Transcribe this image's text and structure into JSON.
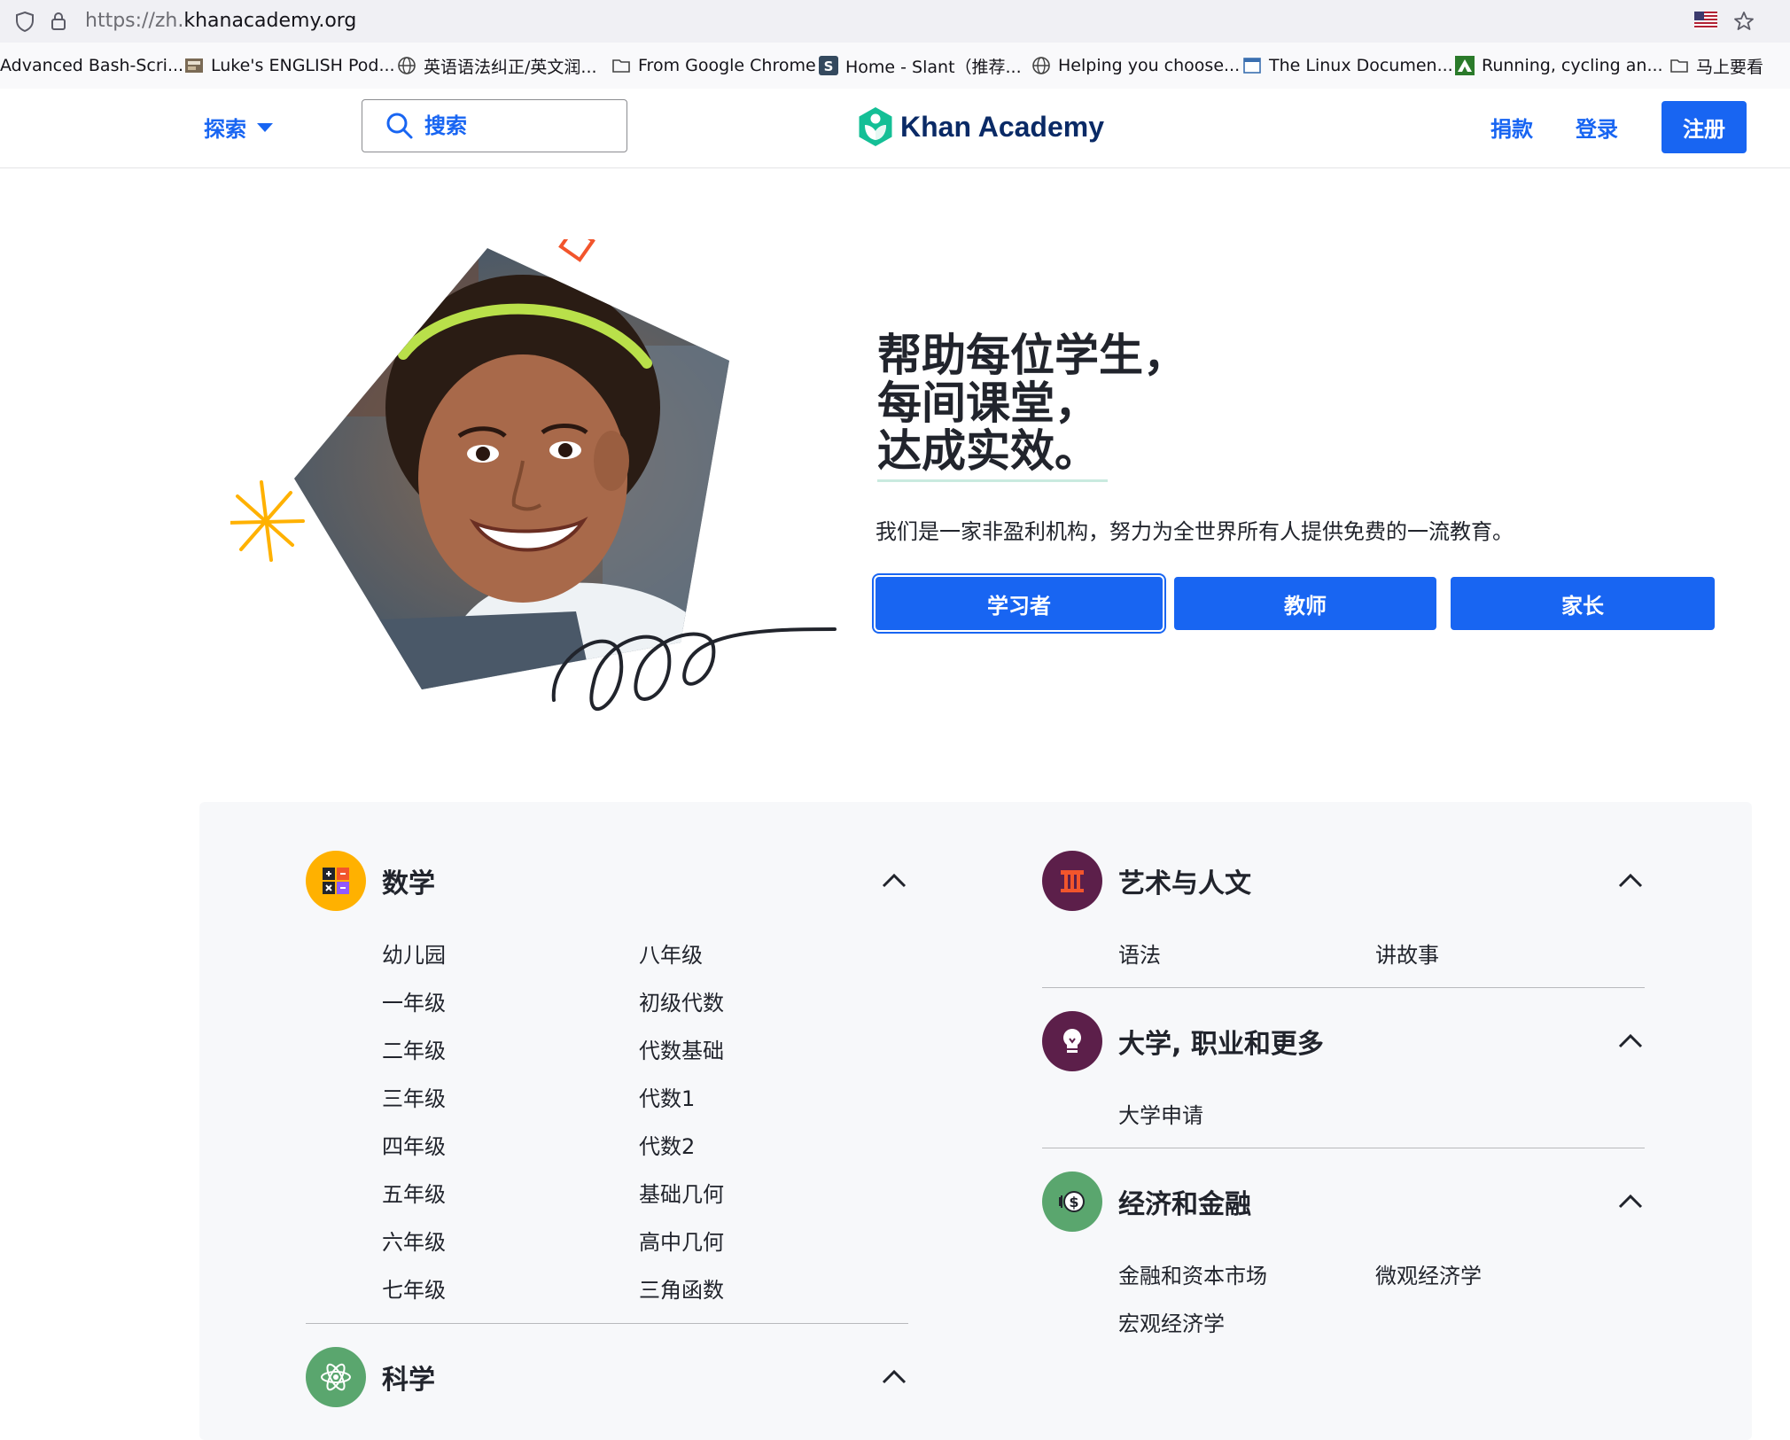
{
  "browser": {
    "url_prefix": "https://zh.",
    "url_domain": "khanacademy.org",
    "bookmarks": [
      {
        "label": "Advanced Bash-Scri...",
        "icon": "none"
      },
      {
        "label": "Luke's ENGLISH Pod...",
        "icon": "podcast-icon"
      },
      {
        "label": "英语语法纠正/英文润...",
        "icon": "globe-icon"
      },
      {
        "label": "From Google Chrome",
        "icon": "folder-icon"
      },
      {
        "label": "Home - Slant（推荐...",
        "icon": "slant-icon"
      },
      {
        "label": "Helping you choose...",
        "icon": "globe-icon"
      },
      {
        "label": "The Linux Documen...",
        "icon": "page-icon"
      },
      {
        "label": "Running, cycling an...",
        "icon": "strava-icon"
      },
      {
        "label": "马上要看",
        "icon": "folder-icon"
      }
    ]
  },
  "header": {
    "explore_label": "探索",
    "search_placeholder": "搜索",
    "brand": "Khan Academy",
    "donate_label": "捐款",
    "login_label": "登录",
    "signup_label": "注册",
    "accent": "#1865f2"
  },
  "hero": {
    "headline_lines": [
      "帮助每位学生，",
      "每间课堂，",
      "达成实效。"
    ],
    "subtitle": "我们是一家非盈利机构，努力为全世界所有人提供免费的一流教育。",
    "buttons": [
      "学习者",
      "教师",
      "家长"
    ]
  },
  "subjects": {
    "math": {
      "title": "数学",
      "col1": [
        "幼儿园",
        "一年级",
        "二年级",
        "三年级",
        "四年级",
        "五年级",
        "六年级",
        "七年级"
      ],
      "col2": [
        "八年级",
        "初级代数",
        "代数基础",
        "代数1",
        "代数2",
        "基础几何",
        "高中几何",
        "三角函数"
      ]
    },
    "science": {
      "title": "科学"
    },
    "arts": {
      "title": "艺术与人文",
      "links": [
        "语法",
        "讲故事"
      ]
    },
    "college": {
      "title": "大学, 职业和更多",
      "links": [
        "大学申请"
      ]
    },
    "economics": {
      "title": "经济和金融",
      "links": [
        "金融和资本市场",
        "微观经济学",
        "宏观经济学"
      ]
    }
  }
}
